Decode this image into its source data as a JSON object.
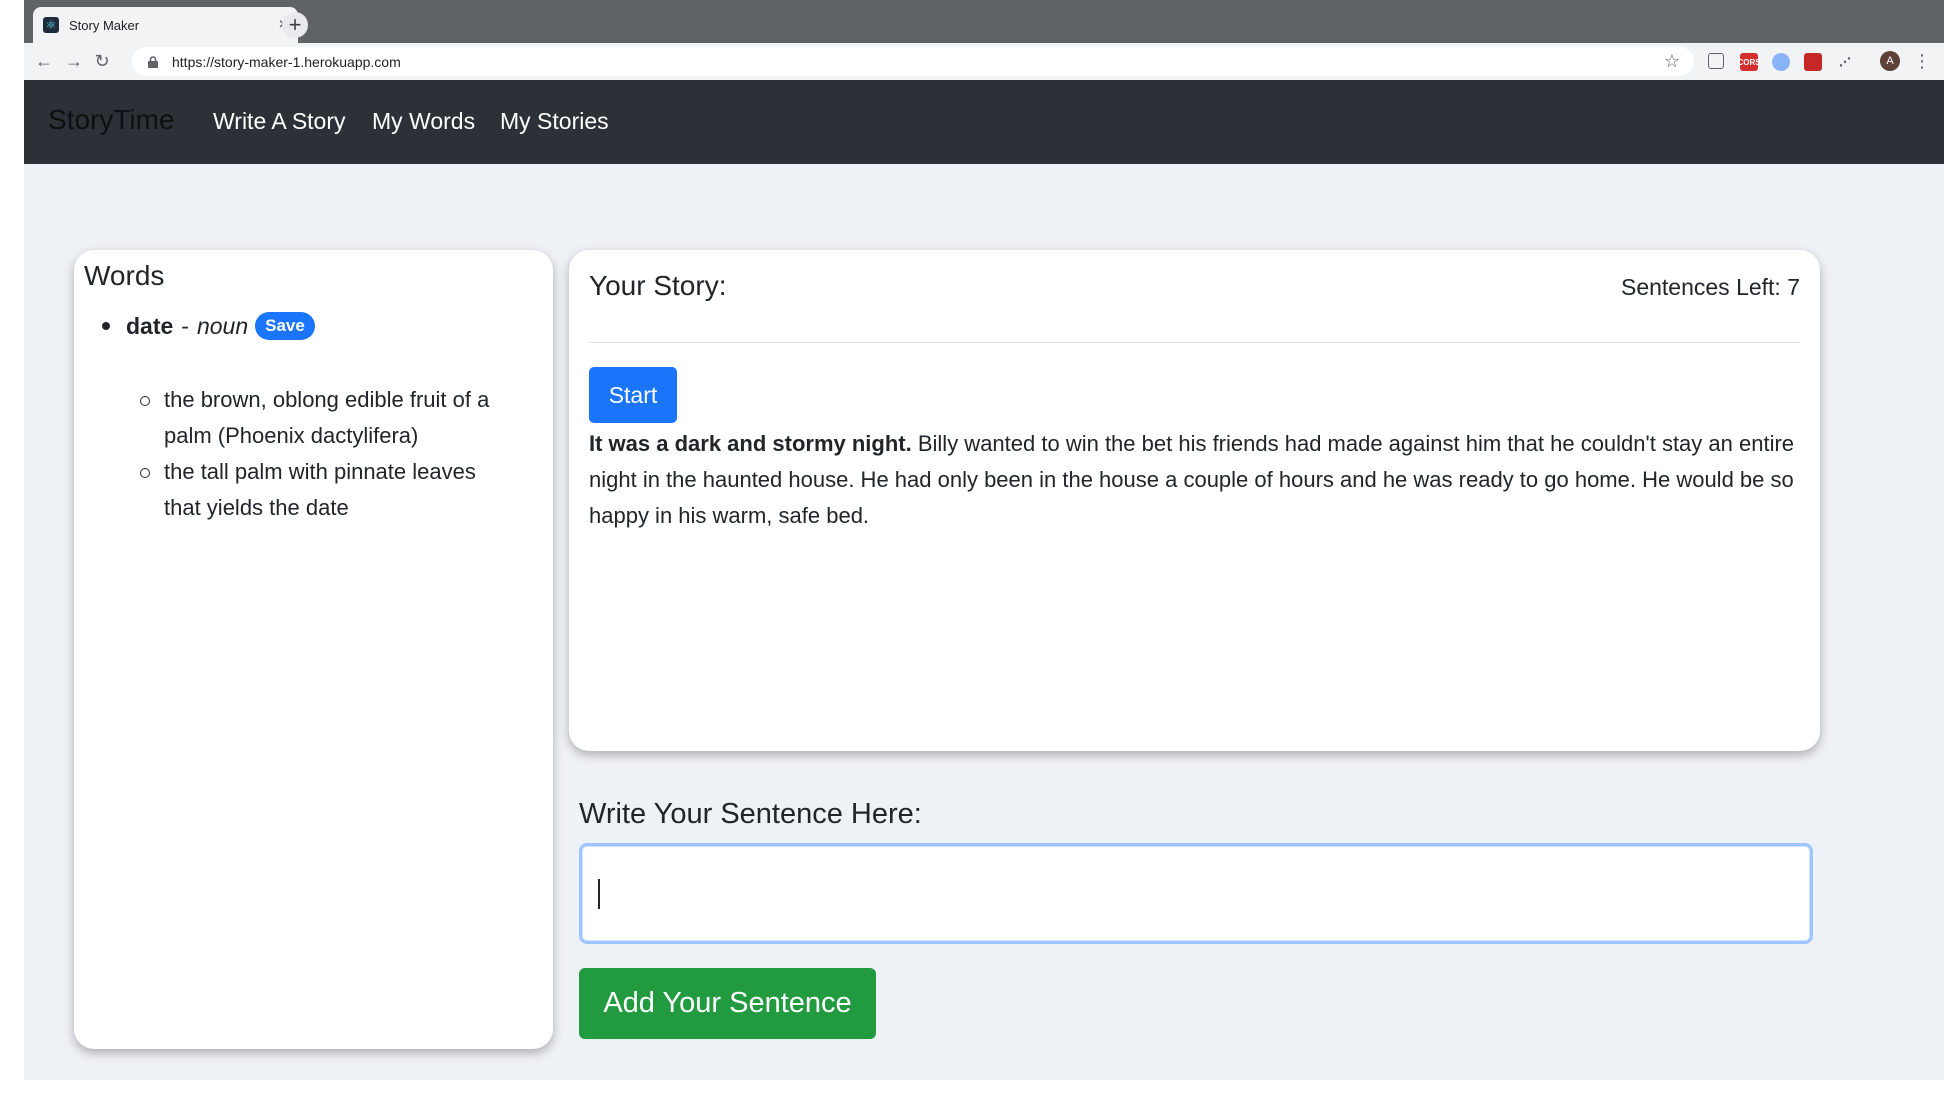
{
  "browser": {
    "tab_title": "Story Maker",
    "tab_close": "×",
    "new_tab": "+",
    "url": "https://story-maker-1.herokuapp.com",
    "avatar_letter": "A",
    "extension_cors_label": "CORS"
  },
  "navbar": {
    "brand": "StoryTime",
    "links": [
      "Write A Story",
      "My Words",
      "My Stories"
    ]
  },
  "words_panel": {
    "title": "Words",
    "word": "date",
    "dash": "-",
    "part_of_speech": "noun",
    "save_label": "Save",
    "definitions": [
      "the brown, oblong edible fruit of a palm (Phoenix dactylifera)",
      "the tall palm with pinnate leaves that yields the date"
    ]
  },
  "story_panel": {
    "title": "Your Story:",
    "sentences_left": "Sentences Left: 7",
    "start_label": "Start",
    "story_opening": "It was a dark and stormy night.",
    "story_body": " Billy wanted to win the bet his friends had made against him that he couldn't stay an entire night in the haunted house. He had only been in the house a couple of hours and he was ready to go home. He would be so happy in his warm, safe bed."
  },
  "sentence_form": {
    "label": "Write Your Sentence Here:",
    "input_value": "",
    "submit_label": "Add Your Sentence"
  },
  "colors": {
    "navbar_bg": "#2c3137",
    "page_bg": "#eef1f6",
    "primary": "#1a75fb",
    "success": "#219a40"
  }
}
